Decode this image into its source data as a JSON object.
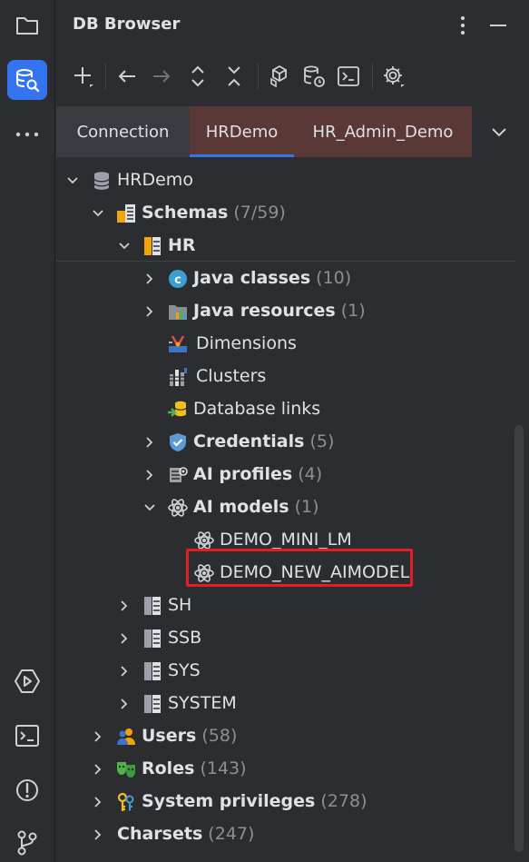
{
  "header": {
    "title": "DB Browser"
  },
  "tabs": [
    {
      "label": "Connection"
    },
    {
      "label": "HRDemo"
    },
    {
      "label": "HR_Admin_Demo"
    }
  ],
  "tree": {
    "root": {
      "label": "HRDemo"
    },
    "schemas": {
      "label": "Schemas",
      "count": "(7/59)"
    },
    "hr": {
      "label": "HR"
    },
    "java_classes": {
      "label": "Java classes",
      "count": "(10)"
    },
    "java_resources": {
      "label": "Java resources",
      "count": "(1)"
    },
    "dimensions": {
      "label": "Dimensions"
    },
    "clusters": {
      "label": "Clusters"
    },
    "database_links": {
      "label": "Database links"
    },
    "credentials": {
      "label": "Credentials",
      "count": "(5)"
    },
    "ai_profiles": {
      "label": "AI profiles",
      "count": "(4)"
    },
    "ai_models": {
      "label": "AI models",
      "count": "(1)"
    },
    "demo_mini_lm": {
      "label": "DEMO_MINI_LM"
    },
    "demo_new_aimodel": {
      "label": "DEMO_NEW_AIMODEL"
    },
    "sh": {
      "label": "SH"
    },
    "ssb": {
      "label": "SSB"
    },
    "sys": {
      "label": "SYS"
    },
    "system": {
      "label": "SYSTEM"
    },
    "users": {
      "label": "Users",
      "count": "(58)"
    },
    "roles": {
      "label": "Roles",
      "count": "(143)"
    },
    "system_privileges": {
      "label": "System privileges",
      "count": "(278)"
    },
    "charsets": {
      "label": "Charsets",
      "count": "(247)"
    }
  },
  "colors": {
    "accent": "#3574f0",
    "highlight": "#e21d27",
    "tab_bg": "#5a3836"
  }
}
